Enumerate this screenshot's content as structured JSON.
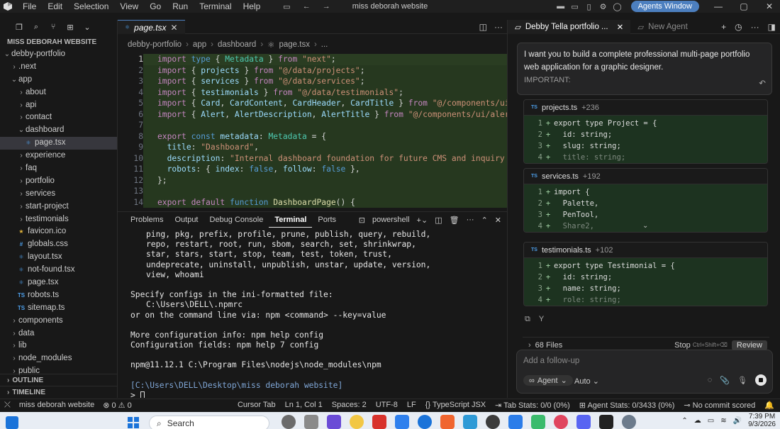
{
  "titlebar": {
    "menu": [
      "File",
      "Edit",
      "Selection",
      "View",
      "Go",
      "Run",
      "Terminal",
      "Help"
    ],
    "title": "miss deborah website",
    "agents_button": "Agents Window"
  },
  "explorer": {
    "root_label": "MISS DEBORAH WEBSITE",
    "items": [
      {
        "label": "debby-portfolio",
        "depth": 0,
        "type": "folder-open"
      },
      {
        "label": ".next",
        "depth": 1,
        "type": "folder"
      },
      {
        "label": "app",
        "depth": 1,
        "type": "folder-open"
      },
      {
        "label": "about",
        "depth": 2,
        "type": "folder"
      },
      {
        "label": "api",
        "depth": 2,
        "type": "folder"
      },
      {
        "label": "contact",
        "depth": 2,
        "type": "folder"
      },
      {
        "label": "dashboard",
        "depth": 2,
        "type": "folder-open"
      },
      {
        "label": "page.tsx",
        "depth": 3,
        "type": "tsx",
        "selected": true
      },
      {
        "label": "experience",
        "depth": 2,
        "type": "folder"
      },
      {
        "label": "faq",
        "depth": 2,
        "type": "folder"
      },
      {
        "label": "portfolio",
        "depth": 2,
        "type": "folder"
      },
      {
        "label": "services",
        "depth": 2,
        "type": "folder"
      },
      {
        "label": "start-project",
        "depth": 2,
        "type": "folder"
      },
      {
        "label": "testimonials",
        "depth": 2,
        "type": "folder"
      },
      {
        "label": "favicon.ico",
        "depth": 2,
        "type": "ico"
      },
      {
        "label": "globals.css",
        "depth": 2,
        "type": "css"
      },
      {
        "label": "layout.tsx",
        "depth": 2,
        "type": "tsx"
      },
      {
        "label": "not-found.tsx",
        "depth": 2,
        "type": "tsx"
      },
      {
        "label": "page.tsx",
        "depth": 2,
        "type": "tsx"
      },
      {
        "label": "robots.ts",
        "depth": 2,
        "type": "ts"
      },
      {
        "label": "sitemap.ts",
        "depth": 2,
        "type": "ts"
      },
      {
        "label": "components",
        "depth": 1,
        "type": "folder"
      },
      {
        "label": "data",
        "depth": 1,
        "type": "folder"
      },
      {
        "label": "lib",
        "depth": 1,
        "type": "folder"
      },
      {
        "label": "node_modules",
        "depth": 1,
        "type": "folder"
      },
      {
        "label": "public",
        "depth": 1,
        "type": "folder"
      }
    ],
    "outline_label": "OUTLINE",
    "timeline_label": "TIMELINE"
  },
  "editor": {
    "tab_label": "page.tsx",
    "breadcrumb": [
      "debby-portfolio",
      "app",
      "dashboard",
      "page.tsx",
      "..."
    ],
    "lines": [
      [
        [
          "kw2",
          "import "
        ],
        [
          "kw",
          "type "
        ],
        [
          "pn",
          "{ "
        ],
        [
          "ty",
          "Metadata"
        ],
        [
          "pn",
          " } "
        ],
        [
          "kw2",
          "from "
        ],
        [
          "str",
          "\"next\""
        ],
        [
          "pn",
          ";"
        ]
      ],
      [
        [
          "kw2",
          "import "
        ],
        [
          "pn",
          "{ "
        ],
        [
          "id",
          "projects"
        ],
        [
          "pn",
          " } "
        ],
        [
          "kw2",
          "from "
        ],
        [
          "str",
          "\"@/data/projects\""
        ],
        [
          "pn",
          ";"
        ]
      ],
      [
        [
          "kw2",
          "import "
        ],
        [
          "pn",
          "{ "
        ],
        [
          "id",
          "services"
        ],
        [
          "pn",
          " } "
        ],
        [
          "kw2",
          "from "
        ],
        [
          "str",
          "\"@/data/services\""
        ],
        [
          "pn",
          ";"
        ]
      ],
      [
        [
          "kw2",
          "import "
        ],
        [
          "pn",
          "{ "
        ],
        [
          "id",
          "testimonials"
        ],
        [
          "pn",
          " } "
        ],
        [
          "kw2",
          "from "
        ],
        [
          "str",
          "\"@/data/testimonials\""
        ],
        [
          "pn",
          ";"
        ]
      ],
      [
        [
          "kw2",
          "import "
        ],
        [
          "pn",
          "{ "
        ],
        [
          "id",
          "Card"
        ],
        [
          "pn",
          ", "
        ],
        [
          "id",
          "CardContent"
        ],
        [
          "pn",
          ", "
        ],
        [
          "id",
          "CardHeader"
        ],
        [
          "pn",
          ", "
        ],
        [
          "id",
          "CardTitle"
        ],
        [
          "pn",
          " } "
        ],
        [
          "kw2",
          "from "
        ],
        [
          "str",
          "\"@/components/ui/card"
        ]
      ],
      [
        [
          "kw2",
          "import "
        ],
        [
          "pn",
          "{ "
        ],
        [
          "id",
          "Alert"
        ],
        [
          "pn",
          ", "
        ],
        [
          "id",
          "AlertDescription"
        ],
        [
          "pn",
          ", "
        ],
        [
          "id",
          "AlertTitle"
        ],
        [
          "pn",
          " } "
        ],
        [
          "kw2",
          "from "
        ],
        [
          "str",
          "\"@/components/ui/alert\""
        ],
        [
          "pn",
          ";"
        ]
      ],
      [],
      [
        [
          "kw2",
          "export "
        ],
        [
          "kw",
          "const "
        ],
        [
          "id",
          "metadata"
        ],
        [
          "pn",
          ": "
        ],
        [
          "ty",
          "Metadata"
        ],
        [
          "pn",
          " = {"
        ]
      ],
      [
        [
          "pn",
          "  "
        ],
        [
          "id",
          "title"
        ],
        [
          "pn",
          ": "
        ],
        [
          "str",
          "\"Dashboard\""
        ],
        [
          "pn",
          ","
        ]
      ],
      [
        [
          "pn",
          "  "
        ],
        [
          "id",
          "description"
        ],
        [
          "pn",
          ": "
        ],
        [
          "str",
          "\"Internal dashboard foundation for future CMS and inquiry manag"
        ]
      ],
      [
        [
          "pn",
          "  "
        ],
        [
          "id",
          "robots"
        ],
        [
          "pn",
          ": { "
        ],
        [
          "id",
          "index"
        ],
        [
          "pn",
          ": "
        ],
        [
          "kw",
          "false"
        ],
        [
          "pn",
          ", "
        ],
        [
          "id",
          "follow"
        ],
        [
          "pn",
          ": "
        ],
        [
          "kw",
          "false"
        ],
        [
          "pn",
          " },"
        ]
      ],
      [
        [
          "pn",
          "};"
        ]
      ],
      [],
      [
        [
          "kw2",
          "export default "
        ],
        [
          "kw",
          "function "
        ],
        [
          "fn",
          "DashboardPage"
        ],
        [
          "pn",
          "() {"
        ]
      ]
    ]
  },
  "panel": {
    "tabs": [
      "Problems",
      "Output",
      "Debug Console",
      "Terminal",
      "Ports"
    ],
    "active_tab": "Terminal",
    "shell": "powershell",
    "terminal_lines": [
      {
        "text": "ping, pkg, prefix, profile, prune, publish, query, rebuild,",
        "indent": true
      },
      {
        "text": "repo, restart, root, run, sbom, search, set, shrinkwrap,",
        "indent": true
      },
      {
        "text": "star, stars, start, stop, team, test, token, trust,",
        "indent": true
      },
      {
        "text": "undeprecate, uninstall, unpublish, unstar, update, version,",
        "indent": true
      },
      {
        "text": "view, whoami",
        "indent": true
      },
      {
        "text": "",
        "indent": false
      },
      {
        "text": "Specify configs in the ini-formatted file:",
        "indent": false
      },
      {
        "text": "C:\\Users\\DELL\\.npmrc",
        "indent": true
      },
      {
        "text": "or on the command line via: npm <command> --key=value",
        "indent": false
      },
      {
        "text": "",
        "indent": false
      },
      {
        "text": "More configuration info: npm help config",
        "indent": false
      },
      {
        "text": "Configuration fields: npm help 7 config",
        "indent": false
      },
      {
        "text": "",
        "indent": false
      },
      {
        "text": "npm@11.12.1 C:\\Program Files\\nodejs\\node_modules\\npm",
        "indent": false
      },
      {
        "text": "",
        "indent": false
      },
      {
        "text": "[C:\\Users\\DELL\\Desktop\\miss deborah website]",
        "indent": false,
        "path": true
      },
      {
        "text": "> ",
        "indent": false,
        "cursor": true
      }
    ]
  },
  "agent": {
    "tab_active": "Debby Tella portfolio ...",
    "tab_new": "New Agent",
    "prompt": "I want you to build a complete professional multi-page portfolio web application for a graphic designer.",
    "prompt_more": "IMPORTANT:",
    "diffs": [
      {
        "file": "projects.ts",
        "added": "+236",
        "lines": [
          [
            "1",
            "export type Project = {"
          ],
          [
            "2",
            "  id: string;"
          ],
          [
            "3",
            "  slug: string;"
          ],
          [
            "4",
            "  title: string;"
          ]
        ]
      },
      {
        "file": "services.ts",
        "added": "+192",
        "lines": [
          [
            "1",
            "import {"
          ],
          [
            "2",
            "  Palette,"
          ],
          [
            "3",
            "  PenTool,"
          ],
          [
            "4",
            "  Share2,"
          ]
        ]
      },
      {
        "file": "testimonials.ts",
        "added": "+102",
        "lines": [
          [
            "1",
            "export type Testimonial = {"
          ],
          [
            "2",
            "  id: string;"
          ],
          [
            "3",
            "  name: string;"
          ],
          [
            "4",
            "  role: string;"
          ]
        ]
      }
    ],
    "files_count": "68 Files",
    "stop_label": "Stop",
    "stop_shortcut": "Ctrl+Shift+⌫",
    "review_label": "Review",
    "followup_placeholder": "Add a follow-up",
    "mode_label": "Agent",
    "model_label": "Auto"
  },
  "statusbar": {
    "workspace": "miss deborah website",
    "problems": "0",
    "warnings": "0",
    "cursor_tab": "Cursor Tab",
    "position": "Ln 1, Col 1",
    "spaces": "Spaces: 2",
    "encoding": "UTF-8",
    "eol": "LF",
    "language": "TypeScript JSX",
    "tab_stats": "Tab Stats: 0/0 (0%)",
    "agent_stats": "Agent Stats: 0/3433 (0%)",
    "commit": "No commit scored"
  },
  "taskbar": {
    "search_label": "Search",
    "time": "7:39 PM",
    "date": "9/3/2026",
    "app_colors": [
      "#6b6b6b",
      "#8a8a8a",
      "#6a4bd6",
      "#f2c744",
      "#d8322c",
      "#2f80ed",
      "#1a73d9",
      "#f0652f",
      "#2e9ad6",
      "#3c3c3c",
      "#2b7de9",
      "#3bbb6d",
      "#e0455f",
      "#5865f2",
      "#222222",
      "#6c7b8c"
    ]
  }
}
